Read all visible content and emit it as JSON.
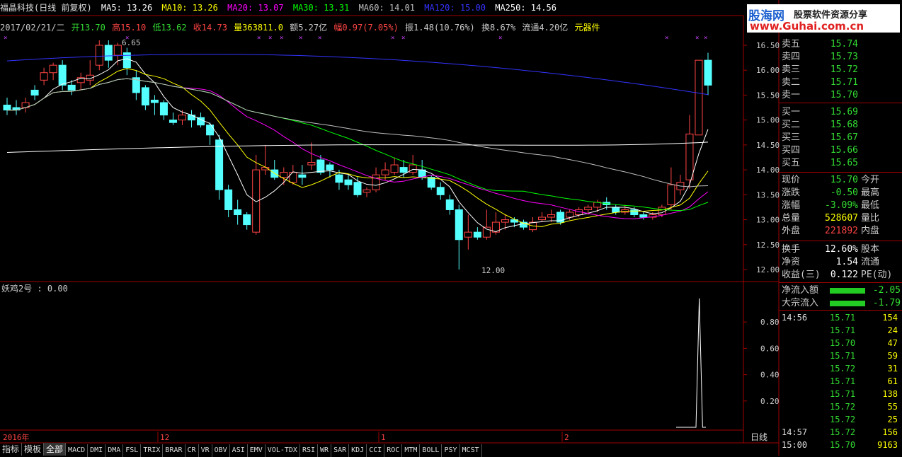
{
  "header": {
    "stock_title": "福晶科技(日线 前复权)",
    "ma5": "MA5: 13.26",
    "ma10": "MA10: 13.26",
    "ma20": "MA20: 13.07",
    "ma30": "MA30: 13.31",
    "ma60": "MA60: 14.01",
    "ma120": "MA120: 15.00",
    "ma250": "MA250: 14.56"
  },
  "info": {
    "date": "2017/02/21/二",
    "open": "开13.70",
    "high": "高15.10",
    "low": "低13.62",
    "close": "收14.73",
    "volume": "量363811.0",
    "amount": "额5.27亿",
    "change": "幅0.97(7.05%)",
    "amplitude": "振1.48(10.76%)",
    "turnover": "换8.67%",
    "float": "流通4.20亿",
    "sector": "元器件"
  },
  "logo": {
    "cn": "股海网",
    "slogan": "股票软件资源分享",
    "url": "www.Guhai.com.cn"
  },
  "price_axis": [
    "16.50",
    "16.00",
    "15.50",
    "15.00",
    "14.50",
    "14.00",
    "13.50",
    "13.00",
    "12.50",
    "12.00"
  ],
  "indicator_axis": [
    "0.80",
    "0.60",
    "0.40",
    "0.20"
  ],
  "annotations": {
    "high_label": "6.65",
    "low_label": "12.00"
  },
  "indicator": {
    "title": "妖鸡2号 : 0.00"
  },
  "time_axis": {
    "year": "2016年",
    "m1": "12",
    "m2": "1",
    "m3": "2",
    "period": "日线"
  },
  "orderbook": {
    "sell": [
      {
        "label": "卖五",
        "price": "15.74"
      },
      {
        "label": "卖四",
        "price": "15.73"
      },
      {
        "label": "卖三",
        "price": "15.72"
      },
      {
        "label": "卖二",
        "price": "15.71"
      },
      {
        "label": "卖一",
        "price": "15.70"
      }
    ],
    "buy": [
      {
        "label": "买一",
        "price": "15.69"
      },
      {
        "label": "买二",
        "price": "15.68"
      },
      {
        "label": "买三",
        "price": "15.67"
      },
      {
        "label": "买四",
        "price": "15.66"
      },
      {
        "label": "买五",
        "price": "15.65"
      }
    ]
  },
  "quote": [
    {
      "l1": "现价",
      "v1": "15.70",
      "l2": "今开",
      "c": "#33dd33"
    },
    {
      "l1": "涨跌",
      "v1": "-0.50",
      "l2": "最高",
      "c": "#33dd33"
    },
    {
      "l1": "涨幅",
      "v1": "-3.09%",
      "l2": "最低",
      "c": "#33dd33"
    },
    {
      "l1": "总量",
      "v1": "528607",
      "l2": "量比",
      "c": "#ffff00"
    },
    {
      "l1": "外盘",
      "v1": "221892",
      "l2": "内盘",
      "c": "#ff4444"
    }
  ],
  "fundamentals": [
    {
      "l1": "换手",
      "v1": "12.60%",
      "l2": "股本"
    },
    {
      "l1": "净资",
      "v1": "1.54",
      "l2": "流通"
    },
    {
      "l1": "收益(三)",
      "v1": "0.122",
      "l2": "PE(动)"
    }
  ],
  "flows": [
    {
      "label": "净流入额",
      "value": "-2.05"
    },
    {
      "label": "大宗流入",
      "value": "-1.79"
    }
  ],
  "ticks": [
    {
      "t": "14:56",
      "p": "15.71",
      "v": "154"
    },
    {
      "t": "",
      "p": "15.71",
      "v": "24"
    },
    {
      "t": "",
      "p": "15.70",
      "v": "47"
    },
    {
      "t": "",
      "p": "15.71",
      "v": "59"
    },
    {
      "t": "",
      "p": "15.72",
      "v": "31"
    },
    {
      "t": "",
      "p": "15.71",
      "v": "61"
    },
    {
      "t": "",
      "p": "15.71",
      "v": "138"
    },
    {
      "t": "",
      "p": "15.72",
      "v": "55"
    },
    {
      "t": "",
      "p": "15.72",
      "v": "25"
    },
    {
      "t": "14:57",
      "p": "15.72",
      "v": "156"
    },
    {
      "t": "15:00",
      "p": "15.70",
      "v": "9163"
    }
  ],
  "bottom_tabs": [
    "指标",
    "模板",
    "全部",
    "MACD",
    "DMI",
    "DMA",
    "FSL",
    "TRIX",
    "BRAR",
    "CR",
    "VR",
    "OBV",
    "ASI",
    "EMV",
    "VOL-TDX",
    "RSI",
    "WR",
    "SAR",
    "KDJ",
    "CCI",
    "ROC",
    "MTM",
    "BOLL",
    "PSY",
    "MCST"
  ],
  "colors": {
    "up": "#ff4444",
    "down": "#54ffff",
    "ma5": "#ffffff",
    "ma10": "#ffff00",
    "ma20": "#ff00ff",
    "ma30": "#00ff00",
    "ma60": "#c0c0c0",
    "ma120": "#3333ff",
    "ma250": "#ffffff"
  },
  "chart_data": {
    "type": "candlestick",
    "price_range": [
      11.8,
      16.6
    ],
    "candles": [
      [
        15.3,
        15.2,
        15.45,
        15.1
      ],
      [
        15.25,
        15.2,
        15.4,
        15.1
      ],
      [
        15.25,
        15.35,
        15.45,
        15.15
      ],
      [
        15.6,
        15.5,
        15.7,
        15.4
      ],
      [
        15.8,
        15.95,
        16.05,
        15.7
      ],
      [
        15.95,
        16.1,
        16.15,
        15.8
      ],
      [
        16.1,
        15.7,
        16.2,
        15.6
      ],
      [
        15.7,
        15.6,
        15.8,
        15.5
      ],
      [
        15.75,
        15.85,
        15.95,
        15.6
      ],
      [
        15.8,
        15.9,
        16.2,
        15.7
      ],
      [
        16.1,
        16.5,
        16.6,
        16.0
      ],
      [
        16.5,
        16.2,
        16.6,
        16.05
      ],
      [
        16.3,
        16.5,
        16.55,
        16.1
      ],
      [
        16.35,
        16.05,
        16.45,
        15.9
      ],
      [
        15.85,
        15.55,
        16.0,
        15.4
      ],
      [
        15.65,
        15.3,
        15.7,
        15.2
      ],
      [
        15.4,
        15.35,
        15.5,
        15.1
      ],
      [
        15.35,
        15.1,
        15.4,
        15.0
      ],
      [
        15.0,
        14.95,
        15.15,
        14.9
      ],
      [
        15.0,
        15.1,
        15.2,
        14.9
      ],
      [
        15.1,
        15.0,
        15.2,
        14.85
      ],
      [
        15.05,
        14.9,
        15.15,
        14.85
      ],
      [
        14.9,
        14.7,
        14.95,
        14.5
      ],
      [
        14.6,
        13.6,
        14.7,
        13.4
      ],
      [
        13.6,
        13.2,
        13.7,
        13.05
      ],
      [
        13.2,
        13.1,
        13.4,
        12.9
      ],
      [
        13.1,
        12.9,
        13.15,
        12.8
      ],
      [
        12.75,
        14.0,
        14.3,
        12.7
      ],
      [
        14.0,
        14.05,
        14.5,
        13.9
      ],
      [
        14.0,
        13.85,
        14.2,
        13.8
      ],
      [
        13.85,
        13.95,
        14.05,
        13.7
      ],
      [
        13.75,
        13.95,
        14.1,
        13.7
      ],
      [
        13.9,
        13.85,
        14.1,
        13.7
      ],
      [
        14.1,
        14.15,
        14.55,
        14.0
      ],
      [
        14.2,
        13.95,
        14.3,
        13.9
      ],
      [
        14.1,
        14.0,
        14.15,
        13.85
      ],
      [
        13.9,
        13.75,
        14.0,
        13.6
      ],
      [
        13.8,
        13.7,
        13.9,
        13.6
      ],
      [
        13.75,
        13.5,
        13.85,
        13.45
      ],
      [
        13.55,
        13.6,
        13.65,
        13.45
      ],
      [
        13.6,
        13.9,
        14.05,
        13.55
      ],
      [
        13.9,
        14.0,
        14.15,
        13.8
      ],
      [
        13.95,
        14.1,
        14.25,
        13.9
      ],
      [
        14.05,
        13.95,
        14.2,
        13.85
      ],
      [
        13.95,
        14.1,
        14.3,
        13.9
      ],
      [
        14.0,
        13.85,
        14.2,
        13.8
      ],
      [
        13.85,
        13.65,
        13.9,
        13.6
      ],
      [
        13.65,
        13.5,
        13.75,
        13.4
      ],
      [
        13.4,
        13.2,
        13.5,
        13.1
      ],
      [
        13.2,
        12.6,
        13.3,
        12.0
      ],
      [
        12.65,
        12.75,
        13.1,
        12.4
      ],
      [
        12.75,
        12.65,
        12.85,
        12.6
      ],
      [
        12.65,
        12.85,
        13.2,
        12.6
      ],
      [
        12.75,
        12.95,
        13.15,
        12.7
      ],
      [
        12.95,
        13.0,
        13.1,
        12.8
      ],
      [
        13.0,
        12.95,
        13.05,
        12.85
      ],
      [
        12.95,
        12.85,
        13.0,
        12.8
      ],
      [
        12.8,
        12.95,
        13.05,
        12.75
      ],
      [
        13.0,
        13.05,
        13.15,
        12.95
      ],
      [
        13.05,
        13.1,
        13.2,
        12.95
      ],
      [
        13.15,
        12.95,
        13.2,
        12.9
      ],
      [
        13.05,
        13.15,
        13.2,
        13.0
      ],
      [
        13.1,
        13.2,
        13.25,
        13.05
      ],
      [
        13.2,
        13.25,
        13.3,
        13.1
      ],
      [
        13.25,
        13.35,
        13.4,
        13.15
      ],
      [
        13.35,
        13.3,
        13.45,
        13.2
      ],
      [
        13.25,
        13.15,
        13.3,
        13.1
      ],
      [
        13.15,
        13.2,
        13.3,
        13.1
      ],
      [
        13.2,
        13.1,
        13.25,
        13.05
      ],
      [
        13.1,
        13.05,
        13.15,
        13.0
      ],
      [
        13.05,
        13.1,
        13.15,
        13.0
      ],
      [
        13.1,
        13.25,
        13.3,
        13.05
      ],
      [
        13.3,
        13.7,
        14.05,
        13.2
      ],
      [
        13.6,
        13.75,
        13.9,
        13.5
      ],
      [
        13.8,
        14.72,
        15.1,
        13.62
      ],
      [
        14.7,
        16.2,
        16.2,
        14.7
      ],
      [
        16.2,
        15.7,
        16.35,
        15.5
      ]
    ],
    "indicator": {
      "title": "妖鸡2号",
      "range": [
        0,
        1
      ],
      "values_last10": [
        0,
        0,
        0,
        0,
        0,
        0,
        0,
        0.98,
        0,
        0
      ]
    }
  }
}
